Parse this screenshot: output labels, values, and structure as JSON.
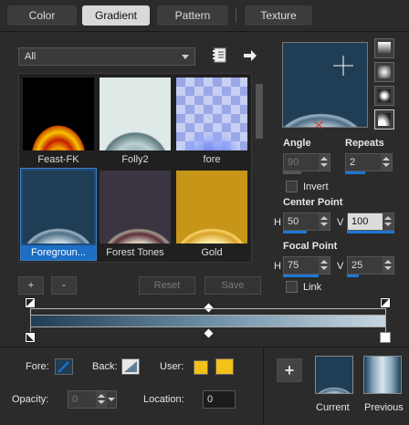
{
  "tabs": [
    {
      "label": "Color",
      "active": false
    },
    {
      "label": "Gradient",
      "active": true
    },
    {
      "label": "Pattern",
      "active": false
    },
    {
      "label": "Texture",
      "active": false
    }
  ],
  "filter": {
    "value": "All"
  },
  "gallery": {
    "items": [
      {
        "label": "Feast-FK",
        "selected": false
      },
      {
        "label": "Folly2",
        "selected": false
      },
      {
        "label": "fore",
        "selected": false
      },
      {
        "label": "Foregroun...",
        "selected": true
      },
      {
        "label": "Forest Tones",
        "selected": false
      },
      {
        "label": "Gold",
        "selected": false
      }
    ]
  },
  "buttons": {
    "add": "+",
    "remove": "-",
    "reset": "Reset",
    "save": "Save",
    "new": "+"
  },
  "angle": {
    "label": "Angle",
    "value": "90"
  },
  "repeats": {
    "label": "Repeats",
    "value": "2"
  },
  "invert": {
    "label": "Invert",
    "checked": false
  },
  "center_point": {
    "label": "Center Point",
    "h_label": "H",
    "h_value": "50",
    "v_label": "V",
    "v_value": "100"
  },
  "focal_point": {
    "label": "Focal Point",
    "h_label": "H",
    "h_value": "75",
    "v_label": "V",
    "v_value": "25"
  },
  "link": {
    "label": "Link",
    "checked": false
  },
  "bottom": {
    "fore_label": "Fore:",
    "back_label": "Back:",
    "user_label": "User:",
    "opacity_label": "Opacity:",
    "opacity_value": "0",
    "location_label": "Location:",
    "location_value": "0",
    "current_label": "Current",
    "previous_label": "Previous"
  },
  "colors": {
    "accent": "#1d77d6",
    "gradient_start": "#1f3d55",
    "gradient_end": "#c7d6e1",
    "user_yellow": "#f2c21b"
  }
}
